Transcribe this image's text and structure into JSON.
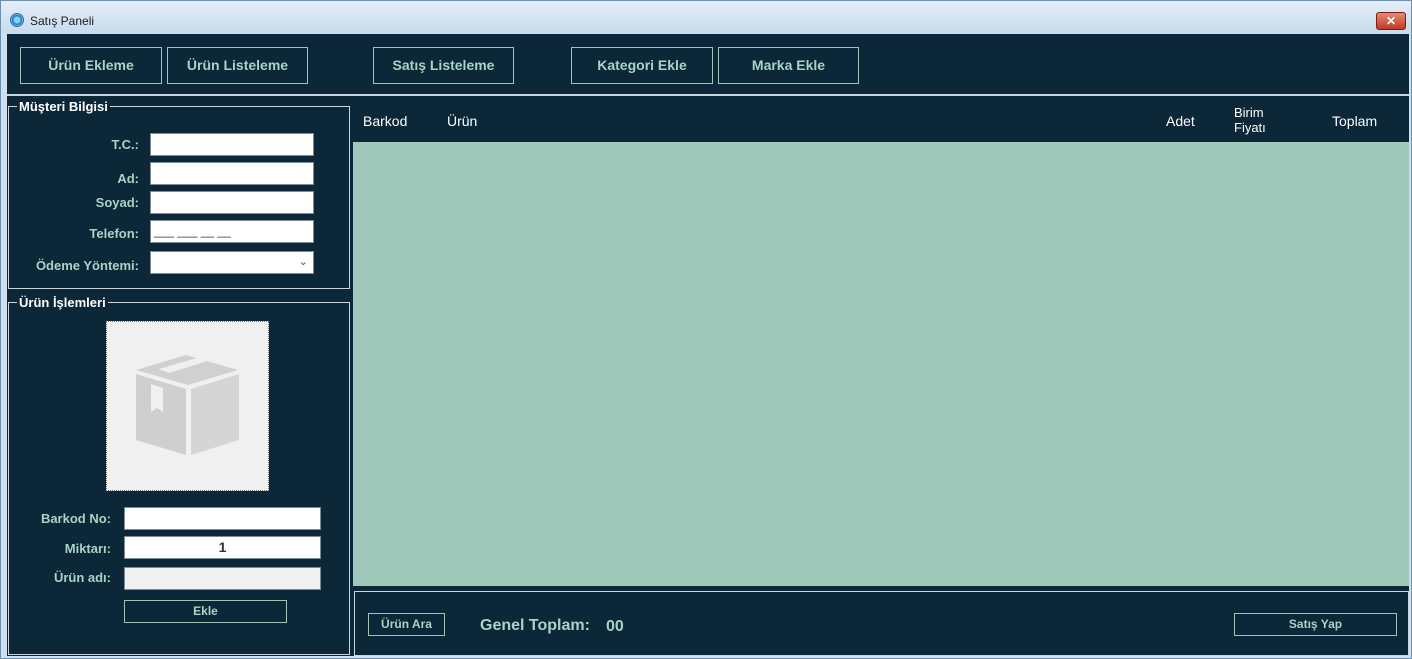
{
  "window": {
    "title": "Satış Paneli",
    "close_glyph": "✕"
  },
  "nav": {
    "buttons": [
      "Ürün Ekleme",
      "Ürün Listeleme",
      "Satış Listeleme",
      "Kategori Ekle",
      "Marka Ekle"
    ]
  },
  "customer": {
    "title": "Müşteri Bilgisi",
    "tc_label": "T.C.:",
    "tc_value": "",
    "name_label": "Ad:",
    "name_value": "",
    "surname_label": "Soyad:",
    "surname_value": "",
    "phone_label": "Telefon:",
    "phone_mask": "___ ___ __ __",
    "payment_label": "Ödeme Yöntemi:",
    "payment_value": ""
  },
  "product": {
    "title": "Ürün İşlemleri",
    "image_icon": "box-icon",
    "barcode_label": "Barkod No:",
    "barcode_value": "",
    "quantity_label": "Miktarı:",
    "quantity_value": "1",
    "name_label": "Ürün adı:",
    "name_value": "",
    "add_button": "Ekle"
  },
  "grid": {
    "columns": [
      "Barkod",
      "Ürün",
      "Adet",
      "Birim Fiyatı",
      "Toplam"
    ],
    "rows": []
  },
  "footer": {
    "search_button": "Ürün Ara",
    "total_label": "Genel Toplam:",
    "total_value": "00",
    "sell_button": "Satış Yap"
  },
  "colors": {
    "panel_bg": "#0b2738",
    "grid_bg": "#9fc8bb",
    "accent_text": "#a8d3c5"
  }
}
